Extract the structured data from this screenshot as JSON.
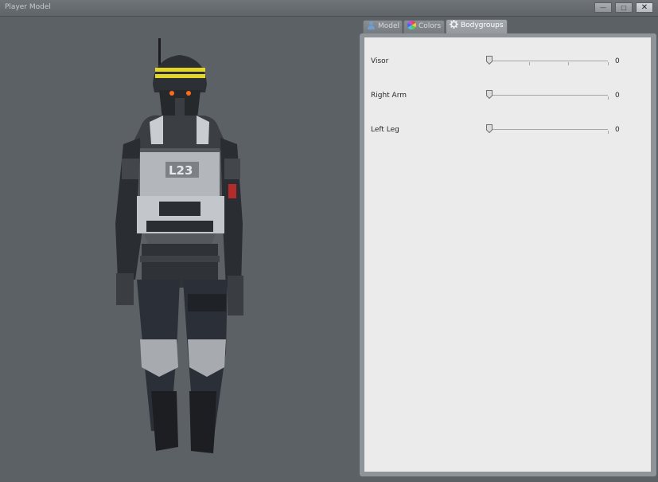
{
  "window": {
    "title": "Player Model",
    "buttons": [
      {
        "name": "minimize",
        "glyph": "—"
      },
      {
        "name": "maximize",
        "glyph": "□"
      },
      {
        "name": "close",
        "glyph": "✕"
      }
    ]
  },
  "tabs": [
    {
      "label": "Model",
      "icon": "person-icon",
      "active": false
    },
    {
      "label": "Colors",
      "icon": "color-wheel-icon",
      "active": false
    },
    {
      "label": "Bodygroups",
      "icon": "gear-icon",
      "active": true
    }
  ],
  "bodygroups": [
    {
      "label": "Visor",
      "value": "0"
    },
    {
      "label": "Right Arm",
      "value": "0"
    },
    {
      "label": "Left Leg",
      "value": "0"
    }
  ],
  "colors": {
    "background": "#5c6166",
    "panel": "#ebebeb",
    "visor_stripe": "#e3d62a",
    "eyes": "#ff6a1a"
  }
}
